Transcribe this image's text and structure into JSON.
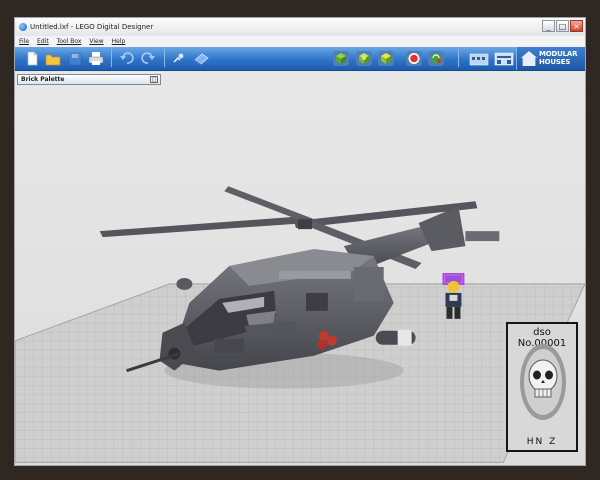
{
  "window": {
    "title": "Untitled.lxf - LEGO Digital Designer",
    "minimize": "_",
    "maximize": "□",
    "close": "×"
  },
  "menu": [
    "File",
    "Edit",
    "Tool Box",
    "View",
    "Help"
  ],
  "toolbar": {
    "icons": [
      "new-file-icon",
      "open-folder-icon",
      "save-icon",
      "print-icon",
      "undo-icon",
      "redo-icon",
      "help-icon",
      "camera-icon",
      "build-mode-icon",
      "view-mode-icon",
      "bricks-icon",
      "colors-icon",
      "share-icon",
      "modular-house-a-icon",
      "modular-house-b-icon"
    ]
  },
  "theme": {
    "line1": "MODULAR",
    "line2": "HOUSES"
  },
  "palette": {
    "title": "Brick Palette",
    "toggle": "□"
  },
  "stamp": {
    "top": "dso No.00001",
    "bottom": "HN Z"
  },
  "colors": {
    "toolbar_blue": "#2f74c8",
    "canvas": "#e4e4e4",
    "helicopter": "#5f5f66",
    "grid": "#bcbcbc"
  }
}
